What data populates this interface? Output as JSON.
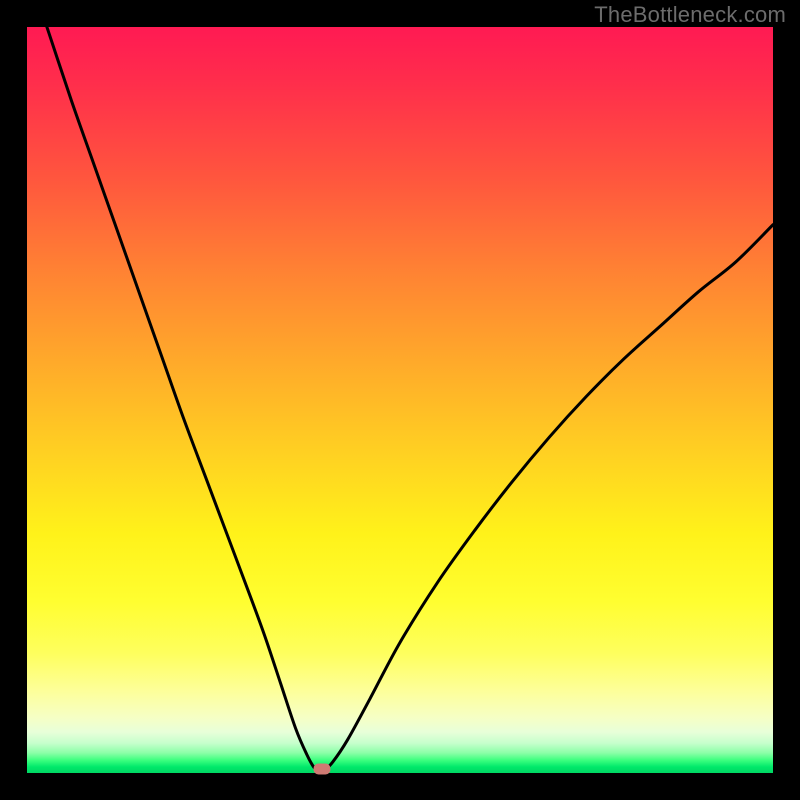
{
  "watermark": "TheBottleneck.com",
  "chart_data": {
    "type": "line",
    "title": "",
    "xlabel": "",
    "ylabel": "",
    "xlim": [
      0,
      100
    ],
    "ylim": [
      0,
      100
    ],
    "grid": false,
    "gradient_colors": {
      "top": "#ff1a53",
      "mid_high": "#ffaa2a",
      "mid_low": "#fff21a",
      "bottom": "#00d763"
    },
    "curve_description": "Asymmetric V-shaped bottleneck curve with minimum near x≈39; left branch steeper than right branch; both rise toward top/right edges.",
    "series": [
      {
        "name": "bottleneck-curve",
        "color": "#000000",
        "x": [
          0.0,
          3.0,
          6.0,
          9.0,
          12.0,
          15.0,
          18.0,
          21.0,
          24.0,
          27.0,
          30.0,
          32.0,
          34.0,
          36.0,
          37.5,
          38.5,
          39.0,
          40.0,
          41.0,
          43.0,
          46.0,
          50.0,
          55.0,
          60.0,
          65.0,
          70.0,
          75.0,
          80.0,
          85.0,
          90.0,
          95.0,
          100.0
        ],
        "y": [
          108.0,
          99.0,
          90.0,
          81.5,
          73.0,
          64.5,
          56.0,
          47.5,
          39.5,
          31.5,
          23.5,
          18.0,
          12.0,
          6.0,
          2.5,
          0.7,
          0.5,
          0.6,
          1.5,
          4.5,
          10.0,
          17.5,
          25.5,
          32.5,
          39.0,
          45.0,
          50.5,
          55.5,
          60.0,
          64.5,
          68.5,
          73.5
        ]
      }
    ],
    "marker": {
      "x": 39.5,
      "y": 0.5,
      "color": "#cf7a73"
    }
  }
}
